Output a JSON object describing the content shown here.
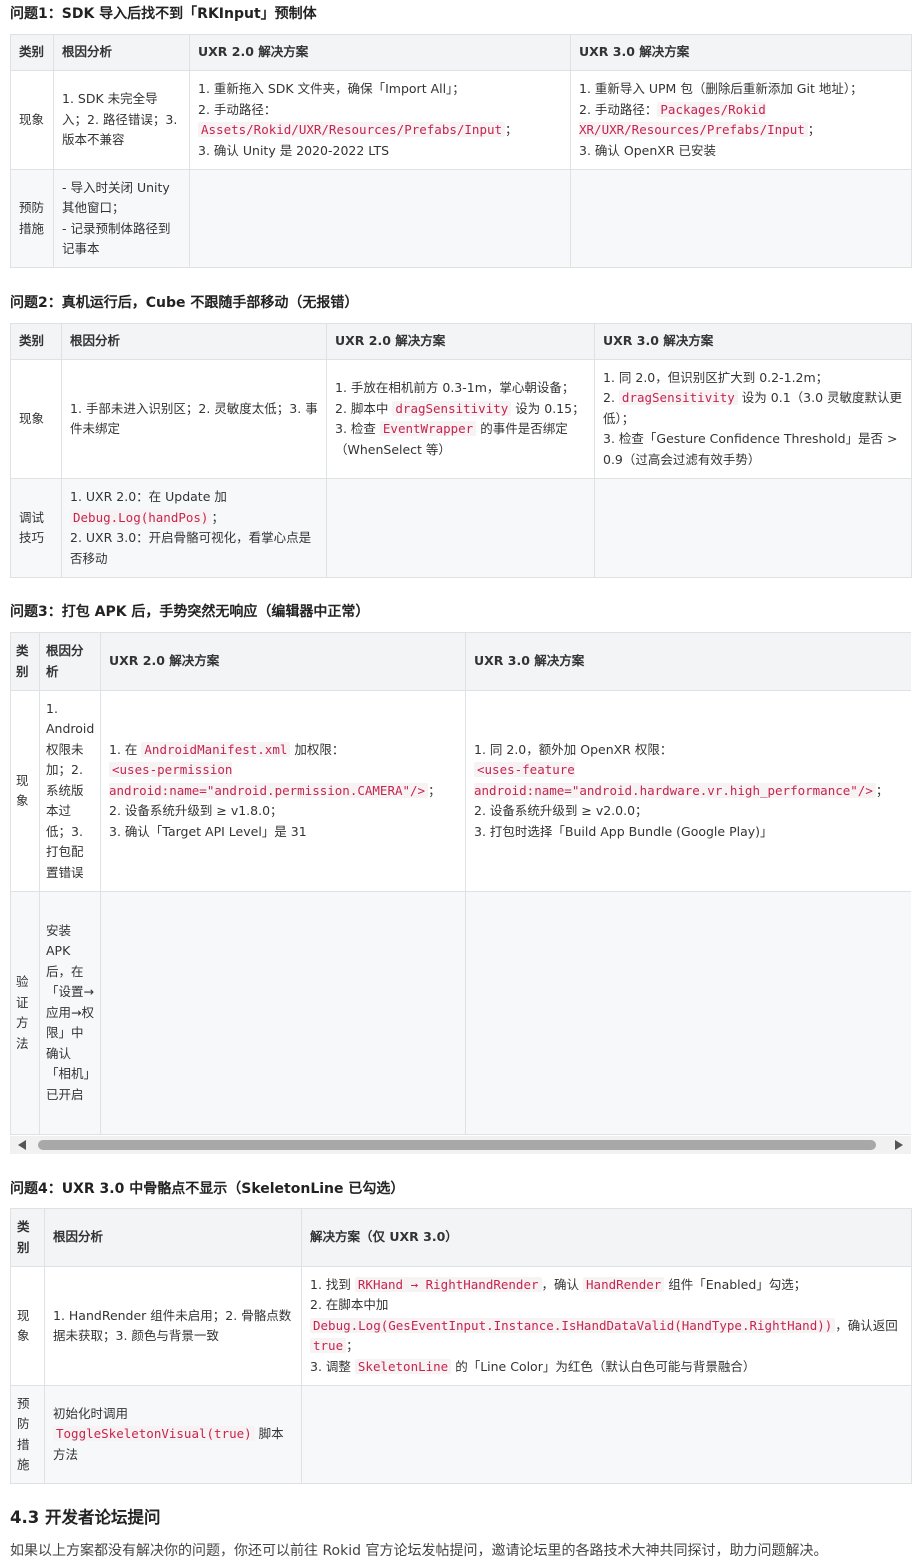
{
  "q1": {
    "title": "问题1：SDK 导入后找不到「RKInput」预制体",
    "headers": [
      "类别",
      "根因分析",
      "UXR 2.0 解决方案",
      "UXR 3.0 解决方案"
    ],
    "row1": {
      "category": "现象",
      "cause": "1. SDK 未完全导入；2. 路径错误；3. 版本不兼容",
      "v2_l1": "1. 重新拖入 SDK 文件夹，确保「Import All」；",
      "v2_l2a": "2. 手动路径：",
      "v2_l2code": "Assets/Rokid/UXR/Resources/Prefabs/Input",
      "v2_l2b": "；",
      "v2_l3": "3. 确认 Unity 是 2020-2022 LTS",
      "v3_l1": "1. 重新导入 UPM 包（删除后重新添加 Git 地址）；",
      "v3_l2a": "2. 手动路径：",
      "v3_l2code": "Packages/Rokid XR/UXR/Resources/Prefabs/Input",
      "v3_l2b": "；",
      "v3_l3": "3. 确认 OpenXR 已安装"
    },
    "row2": {
      "category": "预防措施",
      "cause_l1": "- 导入时关闭 Unity 其他窗口；",
      "cause_l2": "- 记录预制体路径到记事本"
    }
  },
  "q2": {
    "title": "问题2：真机运行后，Cube 不跟随手部移动（无报错）",
    "headers": [
      "类别",
      "根因分析",
      "UXR 2.0 解决方案",
      "UXR 3.0 解决方案"
    ],
    "row1": {
      "category": "现象",
      "cause": "1. 手部未进入识别区；2. 灵敏度太低；3. 事件未绑定",
      "v2_l1": "1. 手放在相机前方 0.3-1m，掌心朝设备；",
      "v2_l2a": "2. 脚本中",
      "v2_l2code": "dragSensitivity",
      "v2_l2b": "设为 0.15；",
      "v2_l3a": "3. 检查",
      "v2_l3code": "EventWrapper",
      "v2_l3b": "的事件是否绑定（WhenSelect 等）",
      "v3_l1": "1. 同 2.0，但识别区扩大到 0.2-1.2m；",
      "v3_l2a": "2.",
      "v3_l2code": "dragSensitivity",
      "v3_l2b": "设为 0.1（3.0 灵敏度默认更低）；",
      "v3_l3": "3. 检查「Gesture Confidence Threshold」是否 > 0.9（过高会过滤有效手势）"
    },
    "row2": {
      "category": "调试技巧",
      "cause_l1a": "1. UXR 2.0：在 Update 加",
      "cause_l1code": "Debug.Log(handPos)",
      "cause_l1b": "；",
      "cause_l2": "2. UXR 3.0：开启骨骼可视化，看掌心点是否移动"
    }
  },
  "q3": {
    "title": "问题3：打包 APK 后，手势突然无响应（编辑器中正常）",
    "headers": [
      "类别",
      "根因分析",
      "UXR 2.0 解决方案",
      "UXR 3.0 解决方案"
    ],
    "row1": {
      "category": "现象",
      "cause": "1. Android 权限未加；2. 系统版本过低；3. 打包配置错误",
      "v2_l1a": "1. 在",
      "v2_l1code": "AndroidManifest.xml",
      "v2_l1b": "加权限：",
      "v2_l2code": "<uses-permission android:name=\"android.permission.CAMERA\"/>",
      "v2_l2b": "；",
      "v2_l3": "2. 设备系统升级到 ≥ v1.8.0；",
      "v2_l4": "3. 确认「Target API Level」是 31",
      "v3_l1": "1. 同 2.0，额外加 OpenXR 权限：",
      "v3_l2code": "<uses-feature android:name=\"android.hardware.vr.high_performance\"/>",
      "v3_l2b": "；",
      "v3_l3": "2. 设备系统升级到 ≥ v2.0.0；",
      "v3_l4": "3. 打包时选择「Build App Bundle (Google Play)」"
    },
    "row2": {
      "category": "验证方法",
      "cause": "安装 APK 后，在「设置→应用→权限」中确认「相机」已开启"
    }
  },
  "q4": {
    "title": "问题4：UXR 3.0 中骨骼点不显示（SkeletonLine 已勾选）",
    "headers": [
      "类别",
      "根因分析",
      "解决方案（仅 UXR 3.0）"
    ],
    "row1": {
      "category": "现象",
      "cause": "1. HandRender 组件未启用；2. 骨骼点数据未获取；3. 颜色与背景一致",
      "s_l1a": "1. 找到",
      "s_l1code1": "RKHand → RightHandRender",
      "s_l1b": "，确认",
      "s_l1code2": "HandRender",
      "s_l1c": "组件「Enabled」勾选；",
      "s_l2a": "2. 在脚本中加",
      "s_l2code": "Debug.Log(GesEventInput.Instance.IsHandDataValid(HandType.RightHand))",
      "s_l2b": "，确认返回",
      "s_l2code2": "true",
      "s_l2c": "；",
      "s_l3a": "3. 调整",
      "s_l3code": "SkeletonLine",
      "s_l3b": "的「Line Color」为红色（默认白色可能与背景融合）"
    },
    "row2": {
      "category": "预防措施",
      "cause_a": "初始化时调用",
      "cause_code": "ToggleSkeletonVisual(true)",
      "cause_b": "脚本方法"
    }
  },
  "section": {
    "title": "4.3 开发者论坛提问",
    "paragraph": "如果以上方案都没有解决你的问题，你还可以前往 Rokid 官方论坛发帖提问，邀请论坛里的各路技术大神共同探讨，助力问题解决。"
  },
  "scrollbar": {
    "left_arrow": "left-arrow-icon",
    "right_arrow": "right-arrow-icon"
  },
  "colors": {
    "code_text": "#c7254e",
    "code_bg": "#f7f2f4",
    "header_bg": "#f3f4f6",
    "border": "#dfe2e5"
  }
}
